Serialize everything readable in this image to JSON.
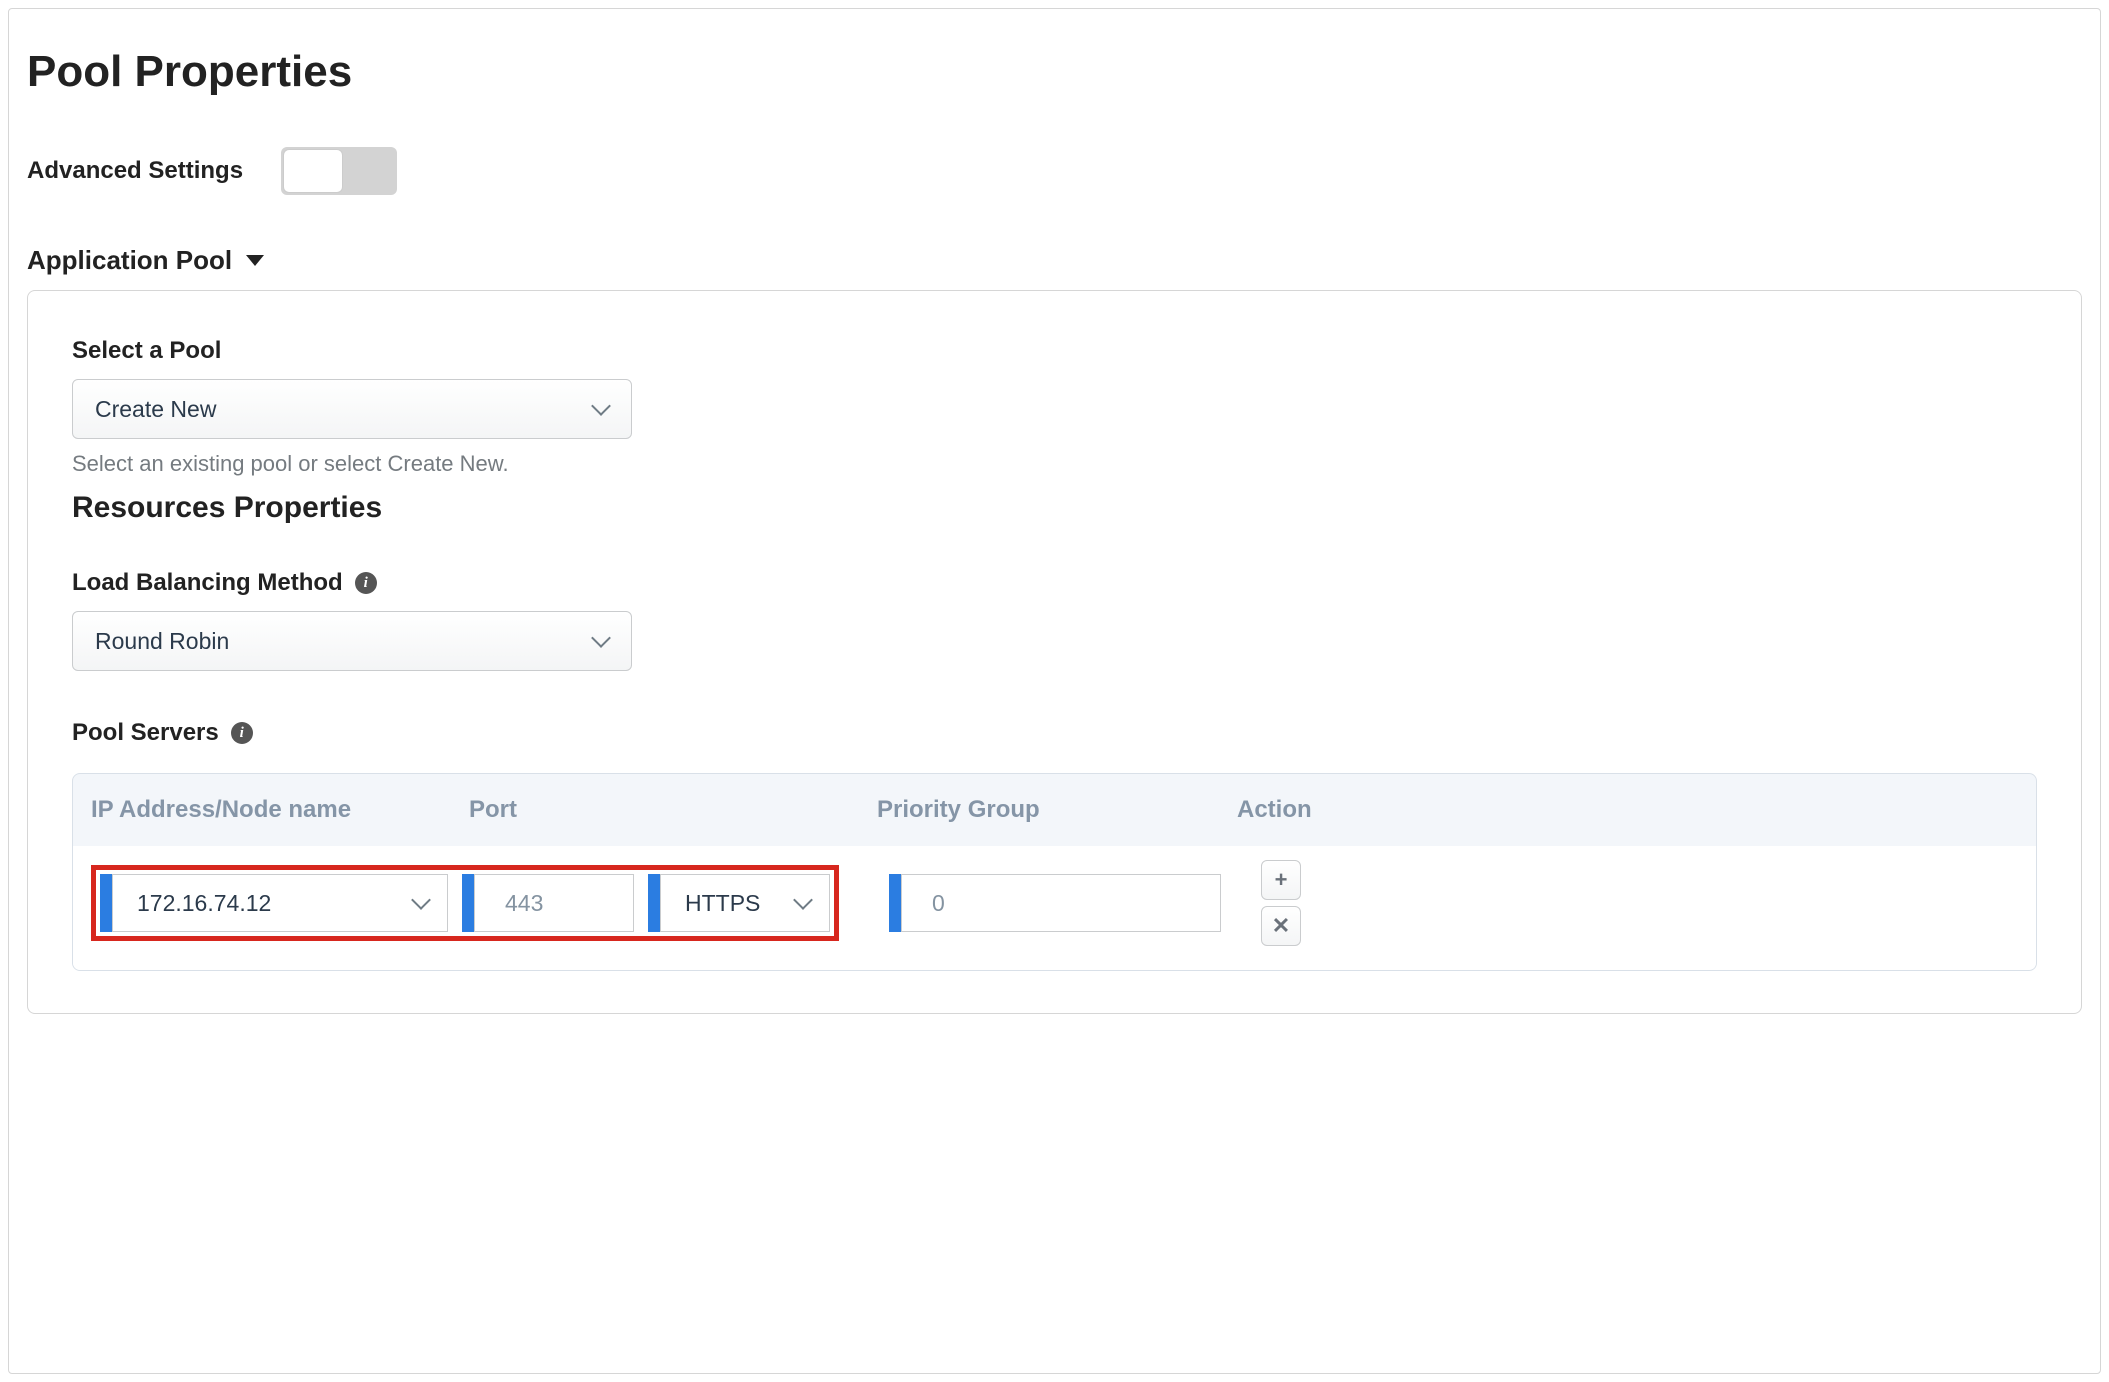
{
  "page": {
    "title": "Pool Properties"
  },
  "advanced": {
    "label": "Advanced Settings"
  },
  "section": {
    "title": "Application Pool"
  },
  "select_pool": {
    "label": "Select a Pool",
    "value": "Create New",
    "helper": "Select an existing pool or select Create New."
  },
  "resources": {
    "heading": "Resources Properties"
  },
  "lb_method": {
    "label": "Load Balancing Method",
    "value": "Round Robin"
  },
  "pool_servers": {
    "label": "Pool Servers",
    "columns": {
      "ip": "IP Address/Node name",
      "port": "Port",
      "priority": "Priority Group",
      "action": "Action"
    },
    "rows": [
      {
        "ip": "172.16.74.12",
        "port": "443",
        "protocol": "HTTPS",
        "priority": "0"
      }
    ]
  },
  "icons": {
    "info": "i",
    "plus": "+",
    "close": "✕"
  }
}
